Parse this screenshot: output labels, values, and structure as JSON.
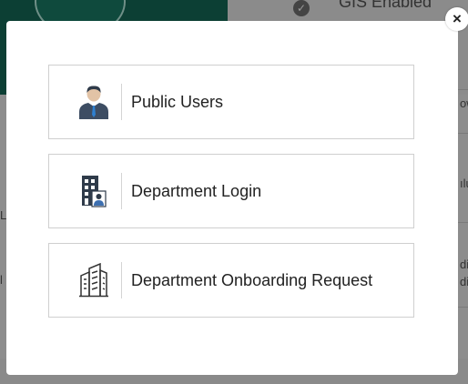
{
  "background": {
    "header_text": "GIS Enabled",
    "edge_fragments": [
      "ow",
      "ılu",
      "di",
      "dic"
    ],
    "left_fragments": [
      "L",
      "l"
    ]
  },
  "modal": {
    "close_label": "×",
    "options": [
      {
        "label": "Public Users",
        "icon": "user-icon"
      },
      {
        "label": "Department Login",
        "icon": "department-building-icon"
      },
      {
        "label": "Department Onboarding Request",
        "icon": "office-building-icon"
      }
    ]
  }
}
